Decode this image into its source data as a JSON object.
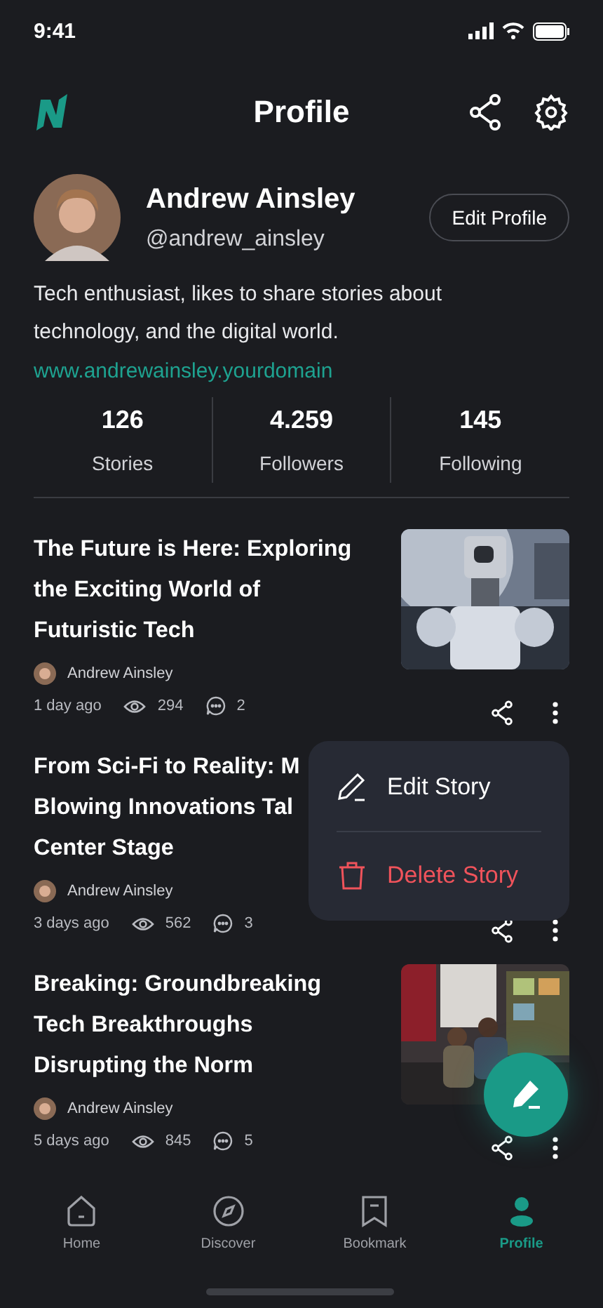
{
  "status_bar": {
    "time": "9:41"
  },
  "header": {
    "title": "Profile"
  },
  "profile": {
    "name": "Andrew Ainsley",
    "handle": "@andrew_ainsley",
    "edit_button": "Edit Profile",
    "bio": "Tech enthusiast, likes to share stories about technology, and the digital world.",
    "link": "www.andrewainsley.yourdomain"
  },
  "stats": [
    {
      "value": "126",
      "label": "Stories"
    },
    {
      "value": "4.259",
      "label": "Followers"
    },
    {
      "value": "145",
      "label": "Following"
    }
  ],
  "stories": [
    {
      "title_lines": [
        "The Future is Here: Exploring",
        "the Exciting World of",
        "Futuristic Tech"
      ],
      "author": "Andrew Ainsley",
      "time": "1 day ago",
      "views": "294",
      "comments": "2",
      "thumbnail": {
        "kind": "picture"
      }
    },
    {
      "title_lines": [
        "From Sci-Fi to Reality: M",
        "Blowing Innovations Tal",
        "Center Stage"
      ],
      "author": "Andrew Ainsley",
      "time": "3 days ago",
      "views": "562",
      "comments": "3"
    },
    {
      "title_lines": [
        "Breaking: Groundbreaking",
        "Tech Breakthroughs",
        "Disrupting the Norm"
      ],
      "author": "Andrew Ainsley",
      "time": "5 days ago",
      "views": "845",
      "comments": "5",
      "thumbnail": {
        "kind": "picture"
      }
    }
  ],
  "menu": {
    "items": [
      {
        "kind": "edit",
        "label": "Edit Story"
      },
      {
        "kind": "delete",
        "label": "Delete Story"
      }
    ]
  },
  "nav": [
    {
      "label": "Home",
      "selected": false
    },
    {
      "label": "Discover",
      "selected": false
    },
    {
      "label": "Bookmark",
      "selected": false
    },
    {
      "label": "Profile",
      "selected": true
    }
  ]
}
